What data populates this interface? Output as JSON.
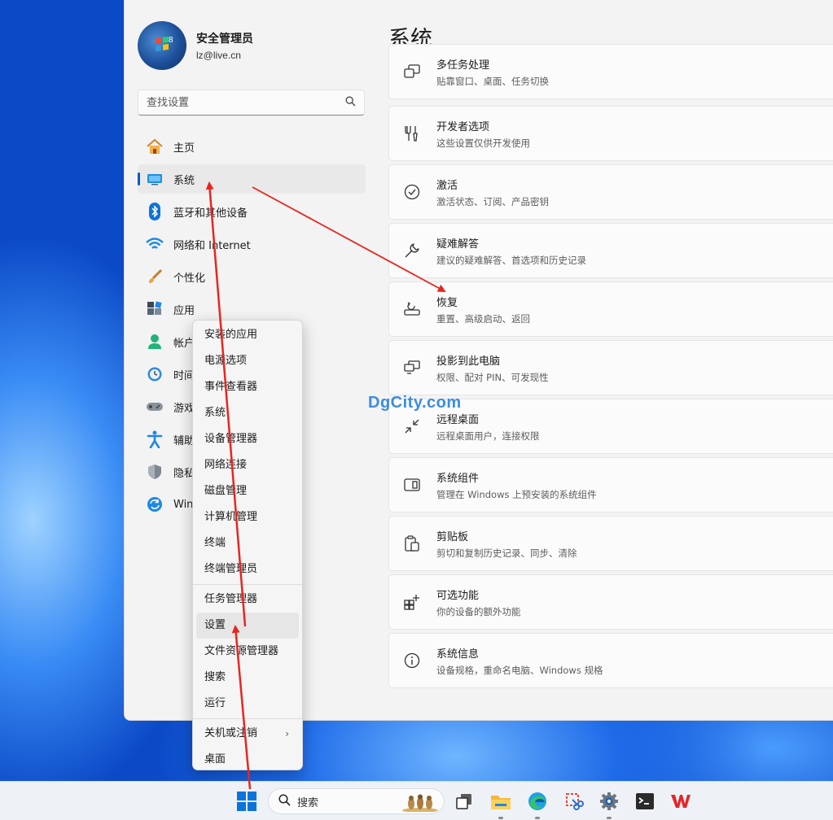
{
  "profile": {
    "name": "安全管理员",
    "email": "lz@live.cn",
    "avatar_badge": "8"
  },
  "search": {
    "placeholder": "查找设置"
  },
  "nav": {
    "items": [
      {
        "label": "主页",
        "icon": "home-icon"
      },
      {
        "label": "系统",
        "icon": "system-icon",
        "active": true
      },
      {
        "label": "蓝牙和其他设备",
        "icon": "bluetooth-icon"
      },
      {
        "label": "网络和 Internet",
        "icon": "wifi-icon"
      },
      {
        "label": "个性化",
        "icon": "brush-icon"
      },
      {
        "label": "应用",
        "icon": "apps-icon"
      },
      {
        "label": "帐户",
        "icon": "account-icon"
      },
      {
        "label": "时间",
        "icon": "clock-icon"
      },
      {
        "label": "游戏",
        "icon": "gamepad-icon"
      },
      {
        "label": "辅助",
        "icon": "accessibility-icon"
      },
      {
        "label": "隐私",
        "icon": "shield-icon"
      },
      {
        "label": "Win",
        "icon": "update-icon"
      }
    ]
  },
  "page": {
    "title": "系统"
  },
  "cards": [
    {
      "title": "多任务处理",
      "subtitle": "贴靠窗口、桌面、任务切换",
      "icon": "multitasking-icon"
    },
    {
      "title": "开发者选项",
      "subtitle": "这些设置仅供开发使用",
      "icon": "developer-tools-icon"
    },
    {
      "title": "激活",
      "subtitle": "激活状态、订阅、产品密钥",
      "icon": "activation-check-icon"
    },
    {
      "title": "疑难解答",
      "subtitle": "建议的疑难解答、首选项和历史记录",
      "icon": "wrench-icon"
    },
    {
      "title": "恢复",
      "subtitle": "重置、高级启动、返回",
      "icon": "recovery-icon"
    },
    {
      "title": "投影到此电脑",
      "subtitle": "权限、配对 PIN、可发现性",
      "icon": "projection-icon"
    },
    {
      "title": "远程桌面",
      "subtitle": "远程桌面用户，连接权限",
      "icon": "remote-desktop-icon"
    },
    {
      "title": "系统组件",
      "subtitle": "管理在 Windows 上预安装的系统组件",
      "icon": "system-components-icon"
    },
    {
      "title": "剪贴板",
      "subtitle": "剪切和复制历史记录、同步、清除",
      "icon": "clipboard-icon"
    },
    {
      "title": "可选功能",
      "subtitle": "你的设备的额外功能",
      "icon": "optional-features-icon"
    },
    {
      "title": "系统信息",
      "subtitle": "设备规格，重命名电脑、Windows 规格",
      "icon": "info-icon"
    }
  ],
  "watermark": "DgCity.com",
  "context_menu": {
    "group1": [
      "安装的应用",
      "电源选项",
      "事件查看器",
      "系统",
      "设备管理器",
      "网络连接",
      "磁盘管理",
      "计算机管理",
      "终端",
      "终端管理员"
    ],
    "group2": [
      "任务管理器",
      "设置",
      "文件资源管理器",
      "搜索",
      "运行"
    ],
    "group3": [
      "关机或注销",
      "桌面"
    ],
    "hovered": "设置",
    "submenu_arrow": "›"
  },
  "taskbar": {
    "search_label": "搜索",
    "apps": [
      "task-view-icon",
      "file-explorer-icon",
      "edge-icon",
      "snipping-tool-icon",
      "settings-gear-icon",
      "terminal-icon",
      "wps-icon"
    ]
  },
  "colors": {
    "accent": "#005fb8",
    "arrow": "#e8261f",
    "watermark": "#3c8de0"
  }
}
